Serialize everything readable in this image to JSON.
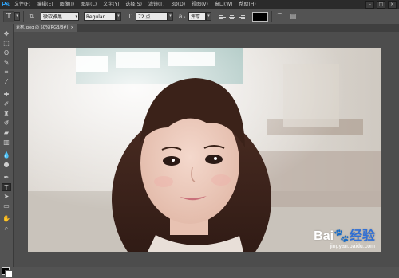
{
  "app": {
    "logo": "Ps"
  },
  "menu": [
    "文件(F)",
    "编辑(E)",
    "图像(I)",
    "图层(L)",
    "文字(Y)",
    "选择(S)",
    "滤镜(T)",
    "3D(D)",
    "视图(V)",
    "窗口(W)",
    "帮助(H)"
  ],
  "window_controls": [
    "–",
    "□",
    "×"
  ],
  "options": {
    "tool_glyph": "T",
    "font_family": "微软雅黑",
    "font_style": "Regular",
    "font_size": "72 点",
    "antialias": "浑厚",
    "text_color": "#000000"
  },
  "document": {
    "tab_title": "素材.jpeg @ 50%(RGB/8#)",
    "close": "×"
  },
  "toolbar": {
    "tools": [
      "move-tool",
      "marquee-tool",
      "lasso-tool",
      "quick-select-tool",
      "crop-tool",
      "eyedropper-tool",
      "healing-brush-tool",
      "brush-tool",
      "clone-stamp-tool",
      "history-brush-tool",
      "eraser-tool",
      "gradient-tool",
      "blur-tool",
      "dodge-tool",
      "pen-tool",
      "type-tool",
      "path-select-tool",
      "shape-tool",
      "hand-tool",
      "zoom-tool"
    ],
    "active_tool": "type-tool",
    "foreground": "#000000",
    "background": "#ffffff"
  },
  "watermark": {
    "main": "Bai",
    "main2": "经验",
    "sub": "jingyan.baidu.com"
  }
}
